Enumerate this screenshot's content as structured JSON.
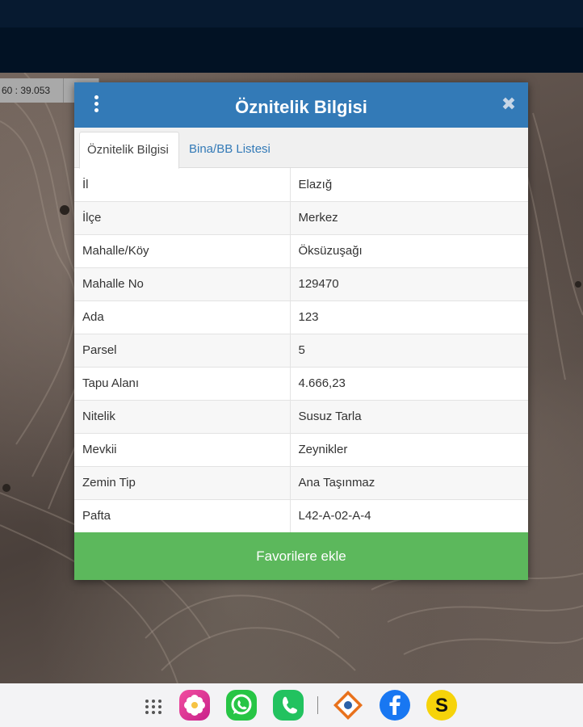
{
  "map": {
    "coordinate_text": "60 : 39.053"
  },
  "dialog": {
    "title": "Öznitelik Bilgisi",
    "close_symbol": "✖",
    "tabs": [
      {
        "label": "Öznitelik Bilgisi",
        "active": true
      },
      {
        "label": "Bina/BB Listesi",
        "active": false
      }
    ],
    "rows": [
      {
        "key": "İl",
        "value": "Elazığ"
      },
      {
        "key": "İlçe",
        "value": "Merkez"
      },
      {
        "key": "Mahalle/Köy",
        "value": "Öksüzuşağı"
      },
      {
        "key": "Mahalle No",
        "value": "129470"
      },
      {
        "key": "Ada",
        "value": "123"
      },
      {
        "key": "Parsel",
        "value": "5"
      },
      {
        "key": "Tapu Alanı",
        "value": "4.666,23"
      },
      {
        "key": "Nitelik",
        "value": "Susuz Tarla"
      },
      {
        "key": "Mevkii",
        "value": "Zeynikler"
      },
      {
        "key": "Zemin Tip",
        "value": "Ana Taşınmaz"
      },
      {
        "key": "Pafta",
        "value": "L42-A-02-A-4"
      }
    ],
    "favorite_button_label": "Favorilere ekle"
  },
  "dock": {
    "apps": [
      {
        "icon": "apps-grid-icon"
      },
      {
        "icon": "gallery-flower-icon",
        "color": "#e6307a"
      },
      {
        "icon": "whatsapp-icon",
        "color": "#25c13f"
      },
      {
        "icon": "phone-icon",
        "color": "#1fbf5a"
      },
      {
        "icon": "tkgm-logo-icon",
        "color": "#e8711c"
      },
      {
        "icon": "facebook-icon",
        "color": "#1877f2"
      },
      {
        "icon": "s-app-icon",
        "color": "#f6d30a"
      }
    ]
  },
  "colors": {
    "header_blue": "#337ab7",
    "button_green": "#5cb85c",
    "topbar": "#021224"
  }
}
